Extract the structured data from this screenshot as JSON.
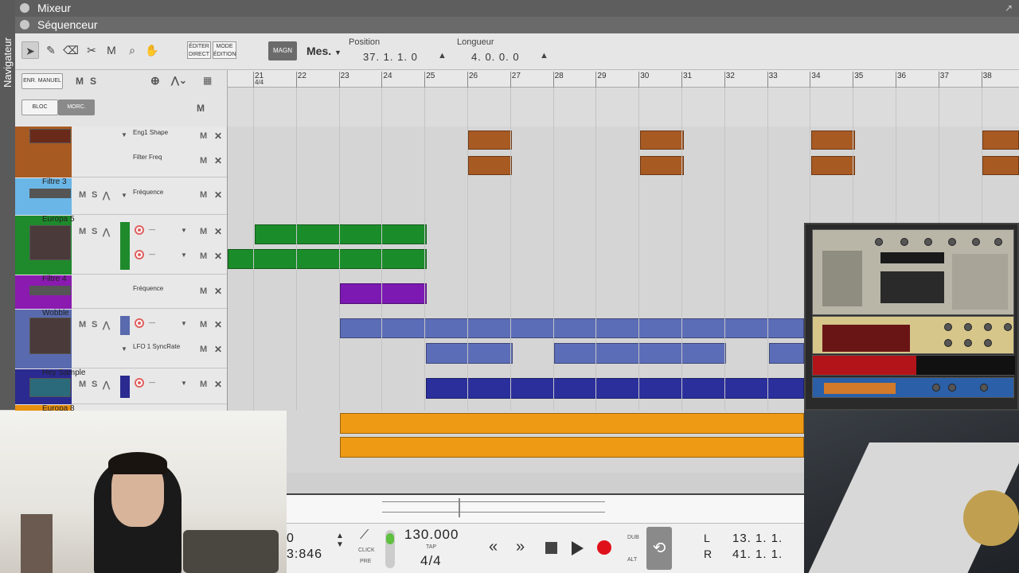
{
  "window": {
    "title_mixer": "Mixeur",
    "title_sequencer": "Séquenceur",
    "navigator_label": "Navigateur"
  },
  "toolbar": {
    "tools": [
      "select-arrow-icon",
      "pencil-icon",
      "eraser-icon",
      "razor-icon",
      "mute-tool-icon",
      "magnify-icon",
      "hand-icon"
    ],
    "edit_direct": "ÉDITER DIRECT",
    "edit_mode": "MODE ÉDITION",
    "snap": "MAGN",
    "snap_value": "Mes.",
    "position_label": "Position",
    "position_value": "37.  1.  1.     0",
    "length_label": "Longueur",
    "length_value": "4.  0.  0.     0"
  },
  "track_header": {
    "manual_rec": "ENR. MANUEL",
    "m": "M",
    "s": "S",
    "bloc": "BLOC",
    "morc": "MORC.",
    "master_m": "M"
  },
  "ruler": {
    "bars": [
      "21",
      "22",
      "23",
      "24",
      "25",
      "26",
      "27",
      "28",
      "29",
      "30",
      "31",
      "32",
      "33",
      "34",
      "35",
      "36",
      "37",
      "38"
    ],
    "signature": "4/4"
  },
  "tracks": [
    {
      "name": "",
      "lanes": [
        "Eng1 Shape",
        "Filter Freq"
      ],
      "color": "#a85a23"
    },
    {
      "name": "Filtre 3",
      "lanes": [
        "Fréquence"
      ],
      "color": "#6ab6e6"
    },
    {
      "name": "Europa 5",
      "lanes": [
        "",
        ""
      ],
      "color": "#1e8a2c"
    },
    {
      "name": "Filtre 4",
      "lanes": [
        "Fréquence"
      ],
      "color": "#8a1ab0"
    },
    {
      "name": "Wobble",
      "lanes": [
        "",
        "LFO 1 SyncRate"
      ],
      "color": "#5a6aae"
    },
    {
      "name": "Hey Sample",
      "lanes": [
        ""
      ],
      "color": "#2a2a90"
    },
    {
      "name": "Europa 8",
      "lanes": [],
      "color": "#e8900f"
    }
  ],
  "transport": {
    "tempo": "130.000",
    "tap": "TAP",
    "signature": "4/4",
    "click": "CLICK",
    "pre": "PRE",
    "dub": "DUB",
    "alt": "ALT",
    "left_pos_top": "0",
    "left_pos_bottom": "3:846",
    "l_label": "L",
    "r_label": "R",
    "l_value": "13.  1.  1.",
    "r_value": "41.  1.  1."
  },
  "colors": {
    "brown": "#a85a23",
    "green": "#1b8c2a",
    "purple": "#7b19b2",
    "blue_clip": "#5c6db8",
    "navy_clip": "#2b2f9c",
    "orange": "#ef9a15",
    "record": "#e0101a"
  }
}
